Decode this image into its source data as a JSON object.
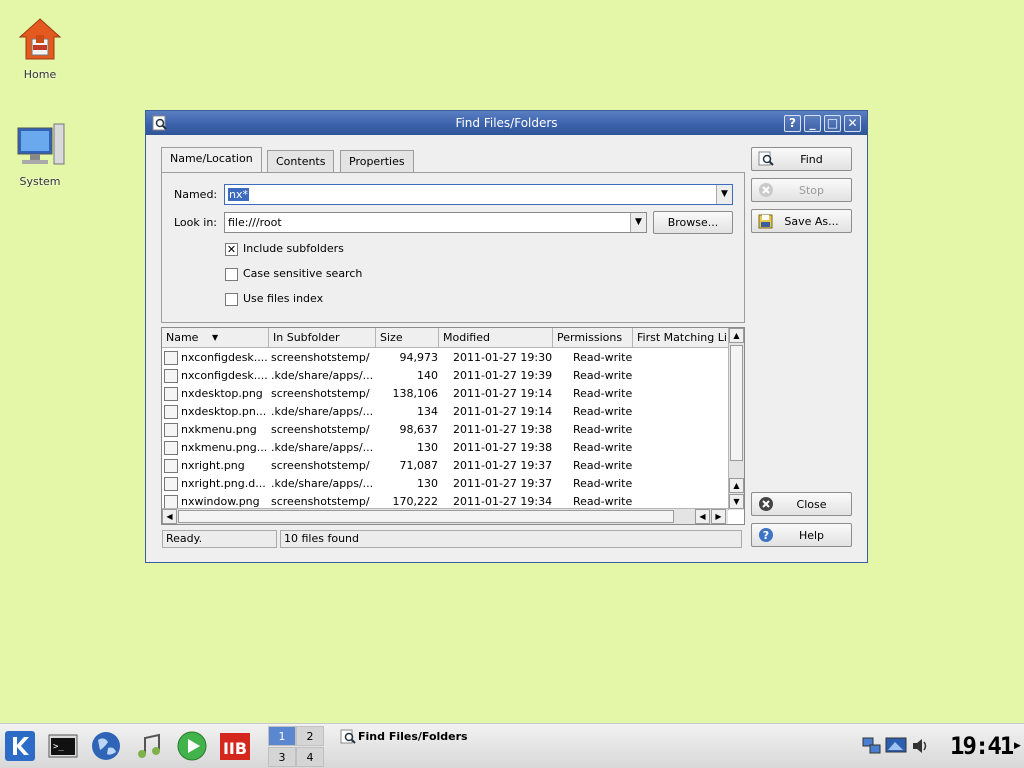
{
  "desktop": {
    "icons": [
      {
        "label": "Home"
      },
      {
        "label": "System"
      }
    ]
  },
  "window": {
    "title": "Find Files/Folders",
    "buttons": {
      "help": "?",
      "minimize": "_",
      "maximize": "□",
      "close": "✕"
    }
  },
  "tabs": [
    {
      "label": "Name/Location",
      "active": true
    },
    {
      "label": "Contents"
    },
    {
      "label": "Properties"
    }
  ],
  "form": {
    "named_label": "Named:",
    "named_value": "nx*",
    "lookin_label": "Look in:",
    "lookin_value": "file:///root",
    "browse_label": "Browse...",
    "include_subfolders": {
      "label": "Include subfolders",
      "checked": true
    },
    "case_sensitive": {
      "label": "Case sensitive search",
      "checked": false
    },
    "use_files_index": {
      "label": "Use files index",
      "checked": false
    }
  },
  "results": {
    "columns": [
      "Name",
      "In Subfolder",
      "Size",
      "Modified",
      "Permissions",
      "First Matching Li"
    ],
    "rows": [
      [
        "nxconfigdesk....",
        "screenshotstemp/",
        "94,973",
        "2011-01-27 19:30",
        "Read-write"
      ],
      [
        "nxconfigdesk....",
        ".kde/share/apps/...",
        "140",
        "2011-01-27 19:39",
        "Read-write"
      ],
      [
        "nxdesktop.png",
        "screenshotstemp/",
        "138,106",
        "2011-01-27 19:14",
        "Read-write"
      ],
      [
        "nxdesktop.pn...",
        ".kde/share/apps/...",
        "134",
        "2011-01-27 19:14",
        "Read-write"
      ],
      [
        "nxkmenu.png",
        "screenshotstemp/",
        "98,637",
        "2011-01-27 19:38",
        "Read-write"
      ],
      [
        "nxkmenu.png...",
        ".kde/share/apps/...",
        "130",
        "2011-01-27 19:38",
        "Read-write"
      ],
      [
        "nxright.png",
        "screenshotstemp/",
        "71,087",
        "2011-01-27 19:37",
        "Read-write"
      ],
      [
        "nxright.png.d...",
        ".kde/share/apps/...",
        "130",
        "2011-01-27 19:37",
        "Read-write"
      ],
      [
        "nxwindow.png",
        "screenshotstemp/",
        "170,222",
        "2011-01-27 19:34",
        "Read-write"
      ]
    ]
  },
  "actions": {
    "find": "Find",
    "stop": "Stop",
    "save_as": "Save As...",
    "close": "Close",
    "help": "Help"
  },
  "status": {
    "state": "Ready.",
    "count": "10 files found"
  },
  "taskbar": {
    "pager": [
      "1",
      "2",
      "3",
      "4"
    ],
    "active_desktop": "1",
    "task_title": "Find Files/Folders",
    "clock": "19:41"
  }
}
